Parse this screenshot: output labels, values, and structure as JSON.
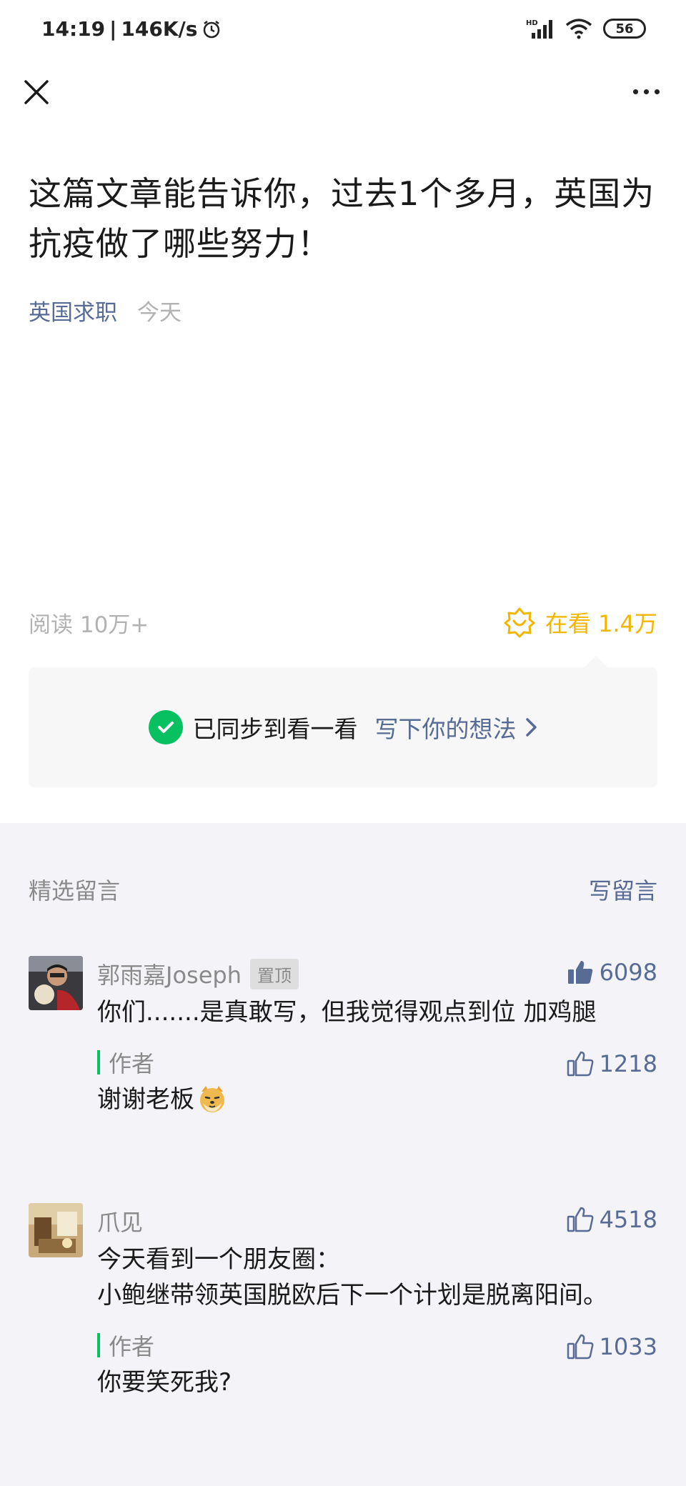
{
  "status_bar": {
    "time": "14:19",
    "speed": "146K/s",
    "battery": "56",
    "network_label": "HD"
  },
  "nav": {
    "close_icon": "close-icon",
    "more_icon": "more-icon"
  },
  "article": {
    "title": "这篇文章能告诉你，过去1个多月，英国为抗疫做了哪些努力！",
    "account": "英国求职",
    "date": "今天",
    "read_count": "阅读 10万+",
    "looking": "在看 1.4万"
  },
  "sync": {
    "text": "已同步到看一看",
    "link": "写下你的想法"
  },
  "comments_section": {
    "title": "精选留言",
    "write": "写留言",
    "comments": [
      {
        "name": "郭雨嘉Joseph",
        "badge": "置顶",
        "likes": "6098",
        "text": "你们.......是真敢写，但我觉得观点到位 加鸡腿",
        "reply_label": "作者",
        "reply_likes": "1218",
        "reply_text": "谢谢老板"
      },
      {
        "name": "爪见",
        "likes": "4518",
        "text": "今天看到一个朋友圈：",
        "text2": "小鲍继带领英国脱欧后下一个计划是脱离阳间。",
        "reply_label": "作者",
        "reply_likes": "1033",
        "reply_text": "你要笑死我?"
      }
    ]
  },
  "colors": {
    "link": "#576b95",
    "looking": "#f2b600",
    "green": "#07c160"
  }
}
